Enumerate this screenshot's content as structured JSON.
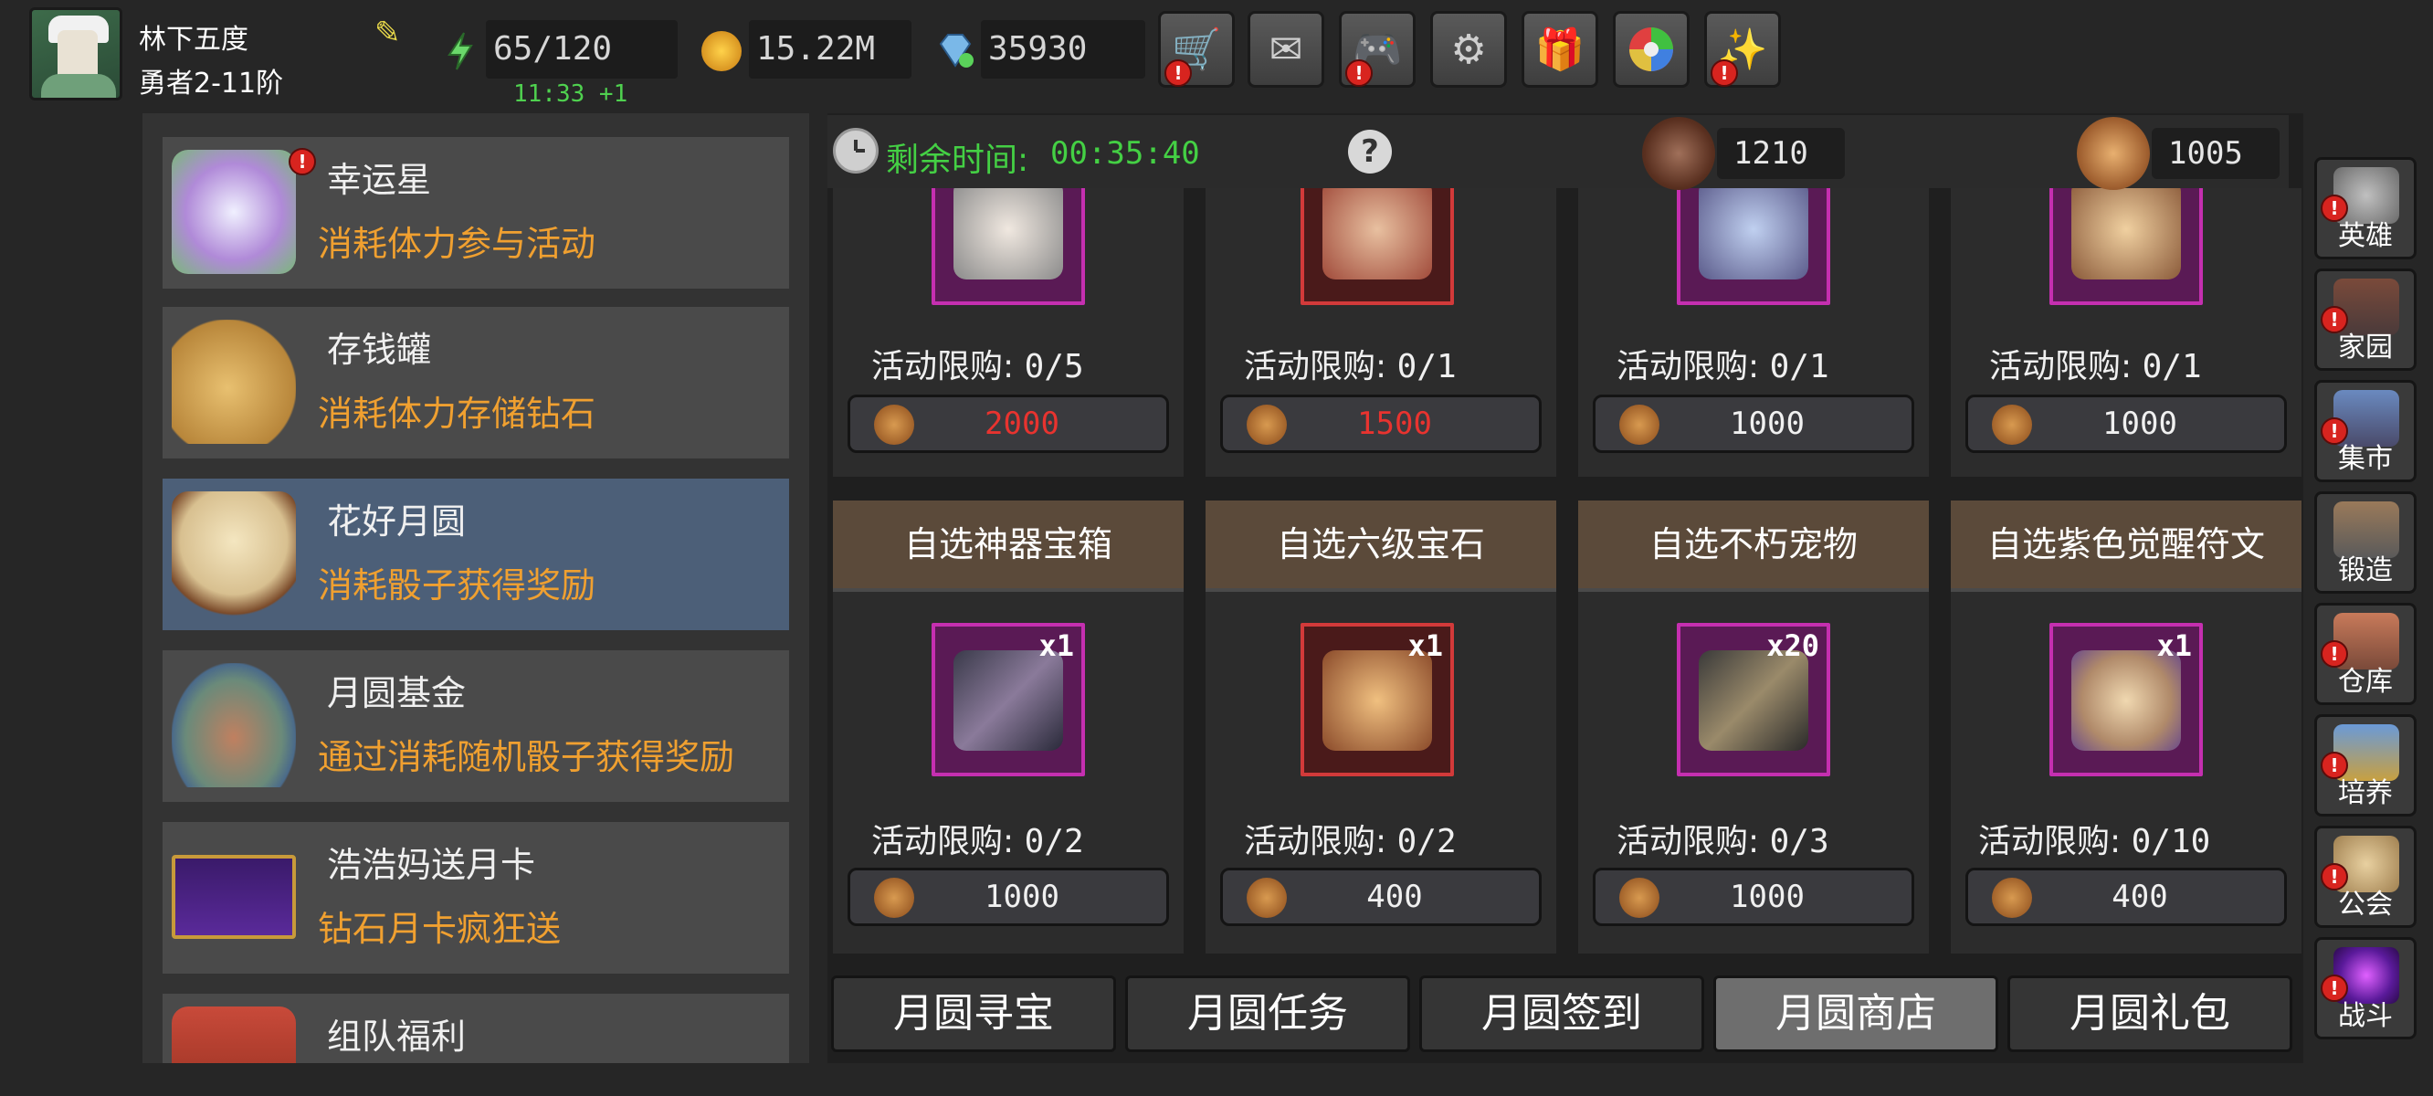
{
  "player": {
    "name": "林下五度",
    "rank": "勇者2-11阶"
  },
  "resources": {
    "stamina": "65/120",
    "stamina_timer": "11:33 +1",
    "gold": "15.22M",
    "diamonds": "35930"
  },
  "toolbar": [
    "shop-cart-icon",
    "mail-icon",
    "gamepad-icon",
    "gear-icon",
    "gift-icon",
    "color-wheel-icon",
    "fireworks-icon"
  ],
  "events": [
    {
      "title": "幸运星",
      "desc": "消耗体力参与活动",
      "icon": "lucky-star-icon"
    },
    {
      "title": "存钱罐",
      "desc": "消耗体力存储钻石",
      "icon": "piggy-bank-icon"
    },
    {
      "title": "花好月圆",
      "desc": "消耗骰子获得奖励",
      "icon": "moon-rabbit-icon"
    },
    {
      "title": "月圆基金",
      "desc": "通过消耗随机骰子获得奖励",
      "icon": "money-bag-icon"
    },
    {
      "title": "浩浩妈送月卡",
      "desc": "钻石月卡疯狂送",
      "icon": "month-card-icon"
    },
    {
      "title": "组队福利",
      "desc": "",
      "icon": "team-gift-icon"
    }
  ],
  "header": {
    "remaining_label": "剩余时间:",
    "countdown": "00:35:40",
    "currency1": "1210",
    "currency2": "1005"
  },
  "top_row": [
    {
      "limit_label": "活动限购:",
      "limit": "0/5",
      "price": "2000",
      "price_red": true
    },
    {
      "limit_label": "活动限购:",
      "limit": "0/1",
      "price": "1500",
      "price_red": true
    },
    {
      "limit_label": "活动限购:",
      "limit": "0/1",
      "price": "1000",
      "price_red": false
    },
    {
      "limit_label": "活动限购:",
      "limit": "0/1",
      "price": "1000",
      "price_red": false
    }
  ],
  "bottom_row": [
    {
      "title": "自选神器宝箱",
      "qty": "x1",
      "limit_label": "活动限购:",
      "limit": "0/2",
      "price": "1000"
    },
    {
      "title": "自选六级宝石",
      "qty": "x1",
      "limit_label": "活动限购:",
      "limit": "0/2",
      "price": "400"
    },
    {
      "title": "自选不朽宠物",
      "qty": "x20",
      "limit_label": "活动限购:",
      "limit": "0/3",
      "price": "1000"
    },
    {
      "title": "自选紫色觉醒符文",
      "qty": "x1",
      "limit_label": "活动限购:",
      "limit": "0/10",
      "price": "400"
    }
  ],
  "tabs": [
    "月圆寻宝",
    "月圆任务",
    "月圆签到",
    "月圆商店",
    "月圆礼包"
  ],
  "active_tab": "月圆商店",
  "right_nav": [
    "英雄",
    "家园",
    "集市",
    "锻造",
    "仓库",
    "培养",
    "公会",
    "战斗"
  ]
}
